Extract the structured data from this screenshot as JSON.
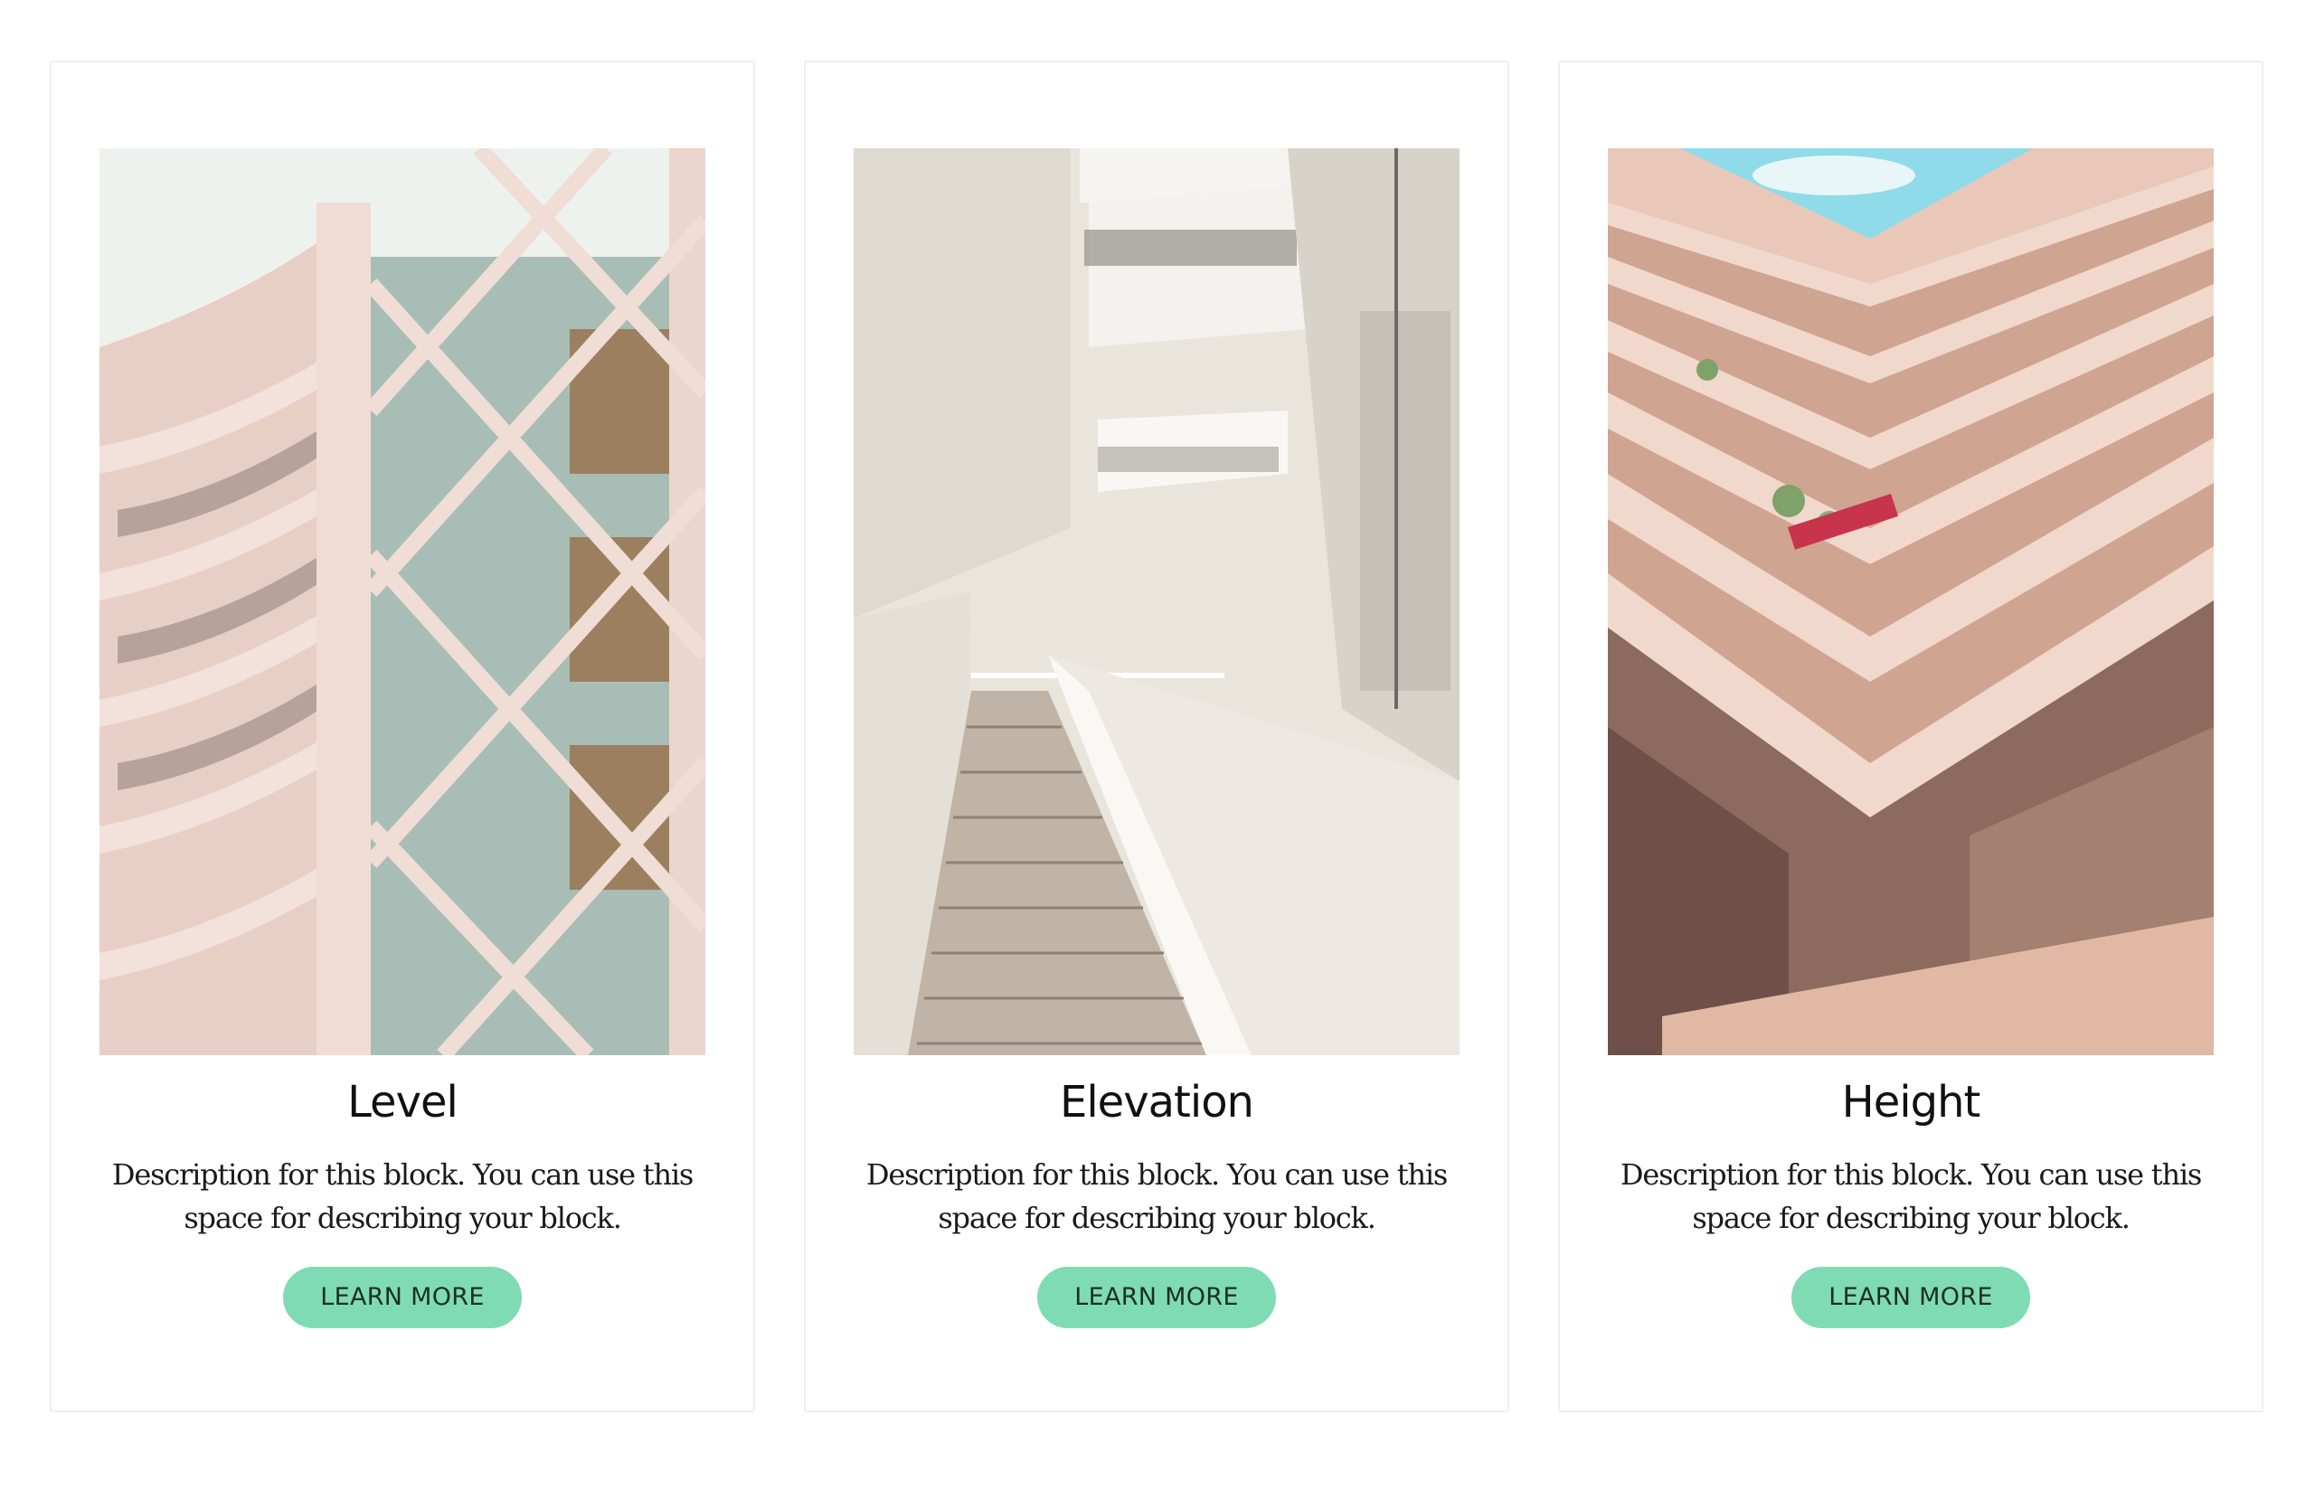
{
  "cards": [
    {
      "title": "Level",
      "description": "Description for this block. You can use this space for describing your block.",
      "button_label": "LEARN MORE",
      "image_subject": "curved-balcony-building-photo"
    },
    {
      "title": "Elevation",
      "description": "Description for this block. You can use this space for describing your block.",
      "button_label": "LEARN MORE",
      "image_subject": "white-atrium-staircase-photo"
    },
    {
      "title": "Height",
      "description": "Description for this block. You can use this space for describing your block.",
      "button_label": "LEARN MORE",
      "image_subject": "atrium-floors-skylight-photo"
    }
  ],
  "colors": {
    "button_bg": "#7fdbb4",
    "card_border": "#efefef",
    "title_text": "#111111"
  }
}
